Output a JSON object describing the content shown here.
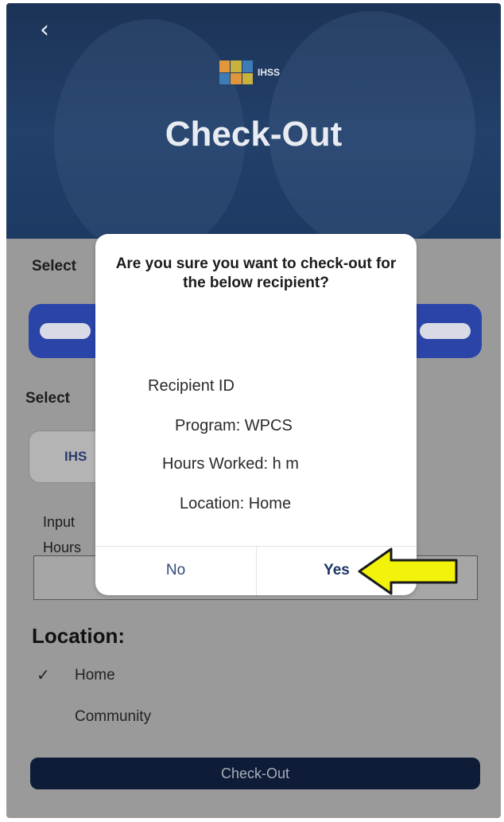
{
  "header": {
    "back_icon": "chevron-left-icon",
    "logo_text": "IHSS",
    "title": "Check-Out"
  },
  "form": {
    "select_label_1": "Select",
    "select_label_2": "Select",
    "program_value": "IHS",
    "input_label": "Input",
    "hours_label": "Hours",
    "location_heading": "Location:",
    "location_options": [
      "Home",
      "Community"
    ],
    "selected_location": "Home",
    "checkout_button": "Check-Out"
  },
  "dialog": {
    "title": "Are you sure you want to check-out for the below recipient?",
    "recipient": "Recipient ID",
    "program": "Program: WPCS",
    "hours": "Hours Worked: h m",
    "location": "Location: Home",
    "no_label": "No",
    "yes_label": "Yes"
  },
  "colors": {
    "header_bg": "#1f3a63",
    "primary_blue": "#2a44a8",
    "checkout_button_bg": "#0f1c38",
    "arrow_fill": "#f2f20a"
  }
}
